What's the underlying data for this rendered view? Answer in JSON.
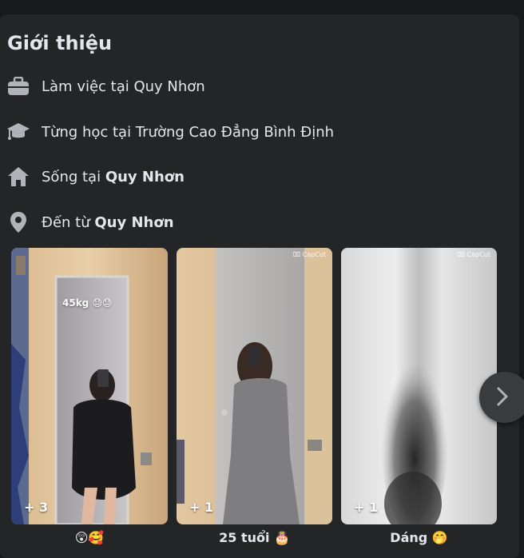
{
  "intro": {
    "title": "Giới thiệu",
    "items": [
      {
        "icon": "briefcase-icon",
        "prefix": "Làm việc tại Quy Nhơn",
        "bold": ""
      },
      {
        "icon": "graduation-cap-icon",
        "prefix": "Từng học tại Trường Cao Đẳng Bình Định",
        "bold": ""
      },
      {
        "icon": "home-icon",
        "prefix": "Sống tại ",
        "bold": "Quy Nhơn"
      },
      {
        "icon": "location-pin-icon",
        "prefix": "Đến từ ",
        "bold": "Quy Nhơn"
      }
    ]
  },
  "featured": [
    {
      "count": "+ 3",
      "overlay": "45kg 😓😓",
      "watermark": "",
      "caption": "😲🥰"
    },
    {
      "count": "+ 1",
      "overlay": "",
      "watermark": "⌧ CapCut",
      "caption": "25 tuổi 🎂"
    },
    {
      "count": "+ 1",
      "overlay": "",
      "watermark": "⌧ CapCut",
      "caption": "Dáng 🤭"
    }
  ],
  "colors": {
    "page_bg": "#18191a",
    "card_bg": "#242526",
    "text_primary": "#e4e6eb",
    "icon_gray": "#b0b3b8",
    "button_bg": "#3a3b3c"
  }
}
